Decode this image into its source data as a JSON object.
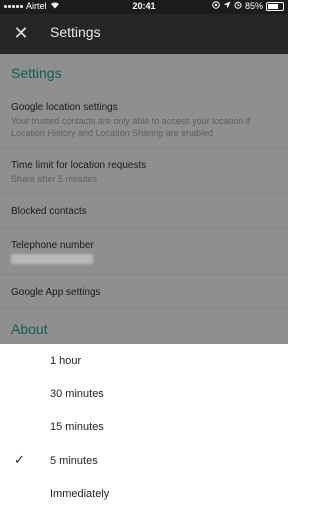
{
  "status_bar": {
    "carrier": "Airtel",
    "time": "20:41",
    "battery": "85%",
    "battery_level": 0.85,
    "icons": [
      "signal-icon",
      "wifi-icon",
      "location-lock-icon",
      "location-arrow-icon",
      "alarm-icon",
      "battery-icon"
    ]
  },
  "app_bar": {
    "title": "Settings",
    "close_icon": "close-icon"
  },
  "settings": {
    "section_title": "Settings",
    "google_location": {
      "title": "Google location settings",
      "subtitle": "Your trusted contacts are only able to access your location if Location History and Location Sharing are enabled"
    },
    "time_limit": {
      "title": "Time limit for location requests",
      "subtitle": "Share after 5 minutes"
    },
    "blocked_contacts": {
      "title": "Blocked contacts"
    },
    "telephone": {
      "title": "Telephone number"
    },
    "google_app": {
      "title": "Google App settings"
    },
    "about_title": "About"
  },
  "sheet": {
    "options": [
      {
        "label": "1 hour",
        "selected": false
      },
      {
        "label": "30 minutes",
        "selected": false
      },
      {
        "label": "15 minutes",
        "selected": false
      },
      {
        "label": "5 minutes",
        "selected": true
      },
      {
        "label": "Immediately",
        "selected": false
      }
    ]
  }
}
